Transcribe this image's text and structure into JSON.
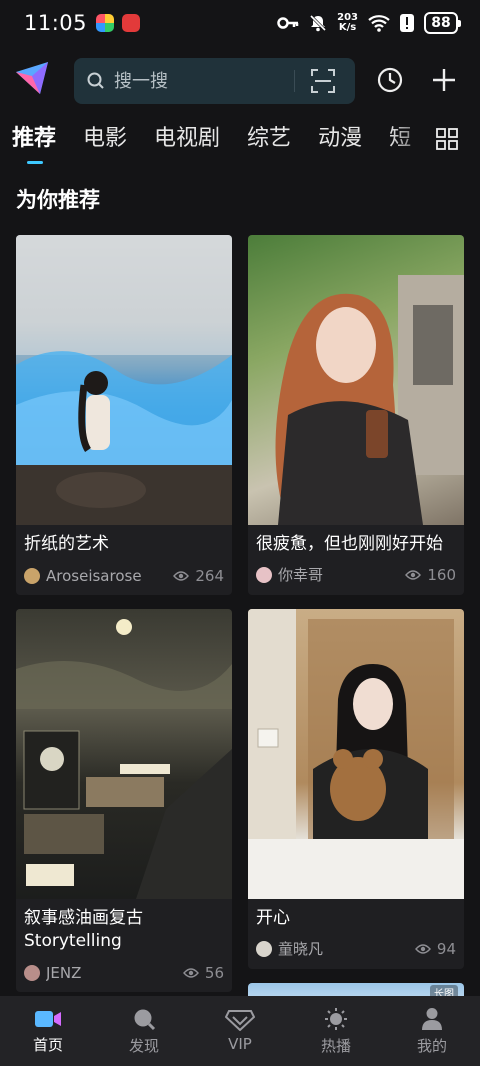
{
  "status": {
    "time": "11:05",
    "net_speed_value": "203",
    "net_speed_unit": "K/s",
    "battery": "88"
  },
  "search": {
    "placeholder": "搜一搜"
  },
  "tabs": [
    {
      "label": "推荐"
    },
    {
      "label": "电影"
    },
    {
      "label": "电视剧"
    },
    {
      "label": "综艺"
    },
    {
      "label": "动漫"
    },
    {
      "label": "短"
    }
  ],
  "section": {
    "title": "为你推荐"
  },
  "cards": [
    {
      "title": "折纸的艺术",
      "author": "Aroseisarose",
      "views": "264"
    },
    {
      "title": "很疲惫，但也刚刚好开始",
      "author": "你幸哥",
      "views": "160"
    },
    {
      "title": "叙事感油画复古Storytelling",
      "author": "JENZ",
      "views": "56"
    },
    {
      "title": "开心",
      "author": "童晓凡",
      "views": "94"
    }
  ],
  "partial_card": {
    "badge": "长图"
  },
  "bottom_nav": [
    {
      "label": "首页"
    },
    {
      "label": "发现"
    },
    {
      "label": "VIP"
    },
    {
      "label": "热播"
    },
    {
      "label": "我的"
    }
  ],
  "colors": {
    "accent": "#3ec9ff",
    "background": "#141416",
    "search_bg": "#20323a",
    "card_bg": "#1f1f22",
    "nav_bg": "#232326"
  }
}
